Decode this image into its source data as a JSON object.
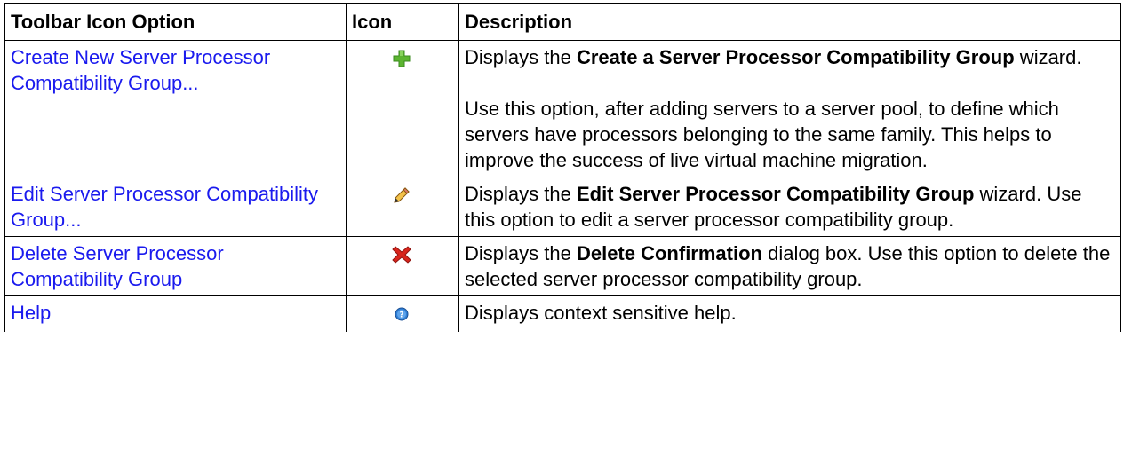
{
  "table": {
    "headers": [
      "Toolbar Icon Option",
      "Icon",
      "Description"
    ],
    "rows": [
      {
        "option": "Create New Server Processor Compatibility Group...",
        "icon": "plus-icon",
        "desc_p1_pre": "Displays the ",
        "desc_p1_bold": "Create a Server Processor Compatibility Group",
        "desc_p1_post": " wizard.",
        "desc_p2": "Use this option, after adding servers to a server pool, to define which servers have processors belonging to the same family. This helps to improve the success of live virtual machine migration."
      },
      {
        "option": "Edit Server Processor Compatibility Group...",
        "icon": "pencil-icon",
        "desc_p1_pre": "Displays the ",
        "desc_p1_bold": "Edit Server Processor Compatibility Group",
        "desc_p1_post": " wizard. Use this option to edit a server processor compatibility group."
      },
      {
        "option": "Delete Server Processor Compatibility Group",
        "icon": "delete-x-icon",
        "desc_p1_pre": "Displays the ",
        "desc_p1_bold": "Delete Confirmation",
        "desc_p1_post": " dialog box. Use this option to delete the selected server processor compatibility group."
      },
      {
        "option": "Help",
        "icon": "help-icon",
        "desc_p1_pre": "Displays context sensitive help."
      }
    ]
  },
  "colors": {
    "link": "#1a1aee",
    "plus_green": "#5cb531",
    "delete_red": "#d8251c",
    "help_blue": "#2f7fd6"
  }
}
